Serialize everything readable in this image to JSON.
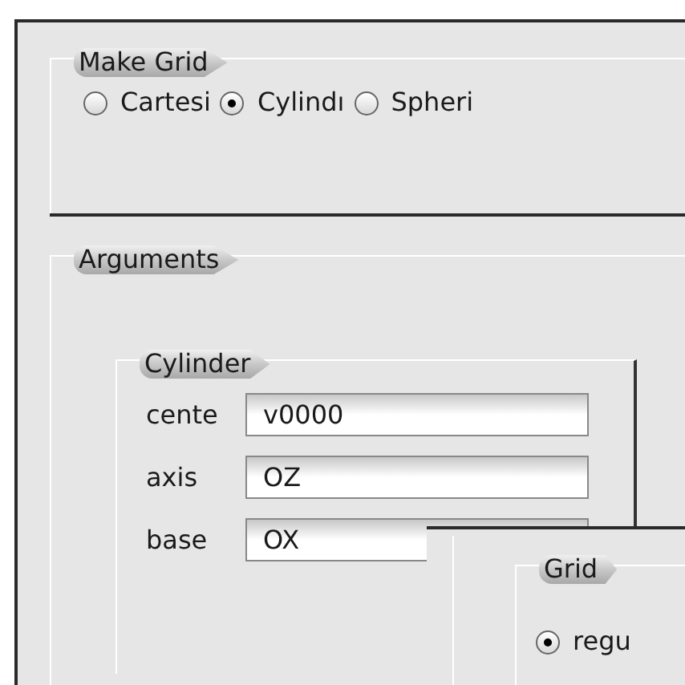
{
  "make_grid": {
    "legend": "Make Grid",
    "options": [
      {
        "label": "Cartesi",
        "selected": false
      },
      {
        "label": "Cylindı",
        "selected": true
      },
      {
        "label": "Spheri",
        "selected": false
      }
    ]
  },
  "arguments": {
    "legend": "Arguments",
    "cylinder": {
      "legend": "Cylinder",
      "fields": [
        {
          "label": "cente",
          "value": "v0000"
        },
        {
          "label": "axis",
          "value": "OZ"
        },
        {
          "label": "base",
          "value": "OX"
        }
      ]
    }
  },
  "overlay": {
    "grid": {
      "legend": "Grid",
      "options": [
        {
          "label": "regu",
          "selected": true
        }
      ]
    }
  }
}
